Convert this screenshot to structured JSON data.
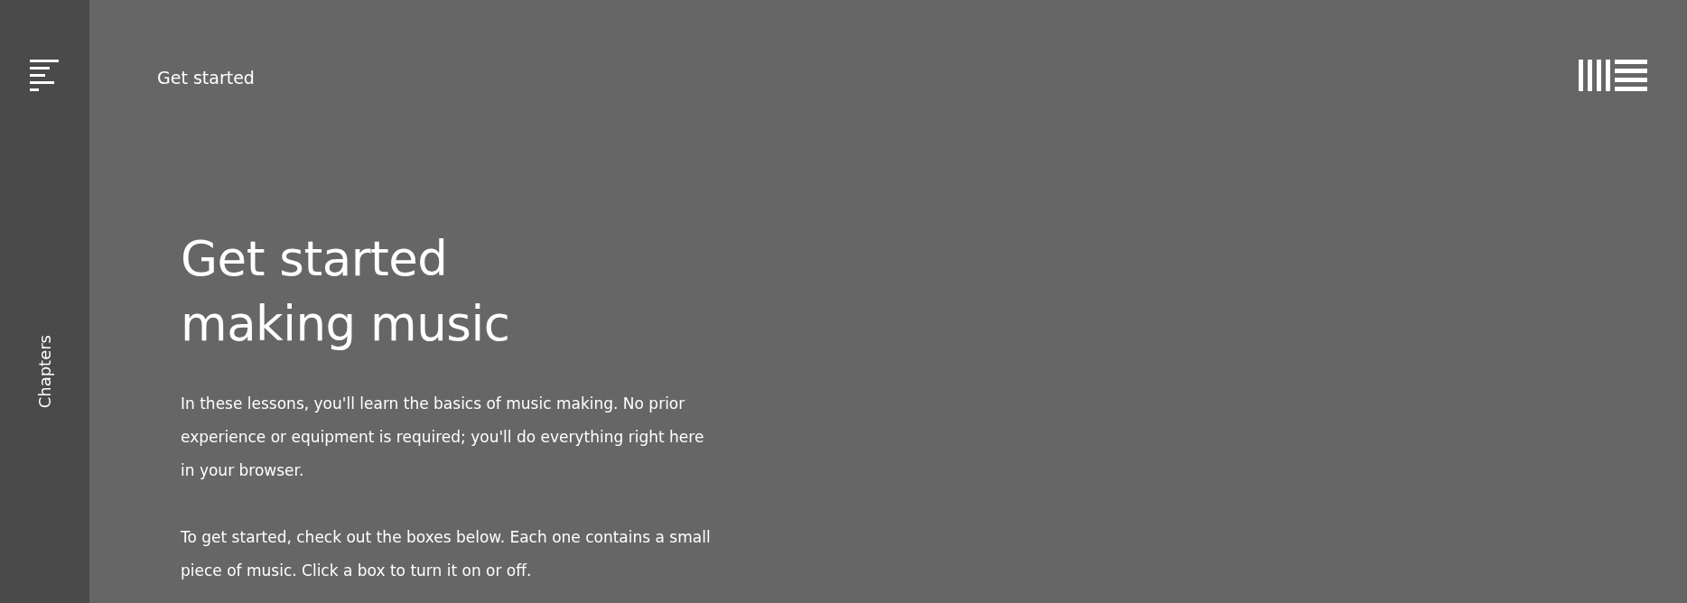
{
  "sidebar": {
    "label": "Chapters"
  },
  "header": {
    "title": "Get started"
  },
  "hero": {
    "heading": [
      "Get started",
      "making music"
    ],
    "paragraphs": [
      "In these lessons, you'll learn the basics of music making. No prior experience or equipment is required; you'll do everything right here in your browser.",
      "To get started, check out the boxes below. Each one contains a small piece of music. Click a box to turn it on or off."
    ]
  }
}
